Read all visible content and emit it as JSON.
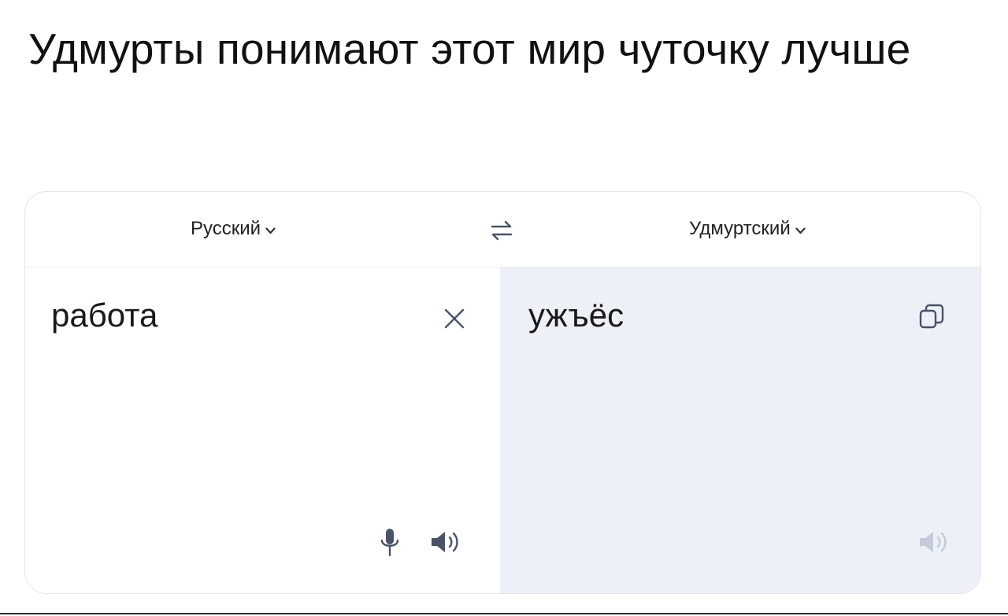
{
  "post": {
    "caption": "Удмурты понимают этот мир чуточку лучше"
  },
  "translator": {
    "source_language": "Русский",
    "target_language": "Удмуртский",
    "source_text": "работа",
    "translated_text": "ужъёс"
  },
  "icons": {
    "source_chevron": "chevron-down-icon",
    "target_chevron": "chevron-down-icon",
    "swap": "swap-arrows-icon",
    "clear": "close-icon",
    "copy": "copy-icon",
    "microphone": "microphone-icon",
    "source_speaker": "speaker-icon",
    "target_speaker": "speaker-icon"
  },
  "colors": {
    "card_border": "#e3e5ea",
    "target_pane_background": "#eef0f7",
    "icon_active": "#4a5268",
    "icon_muted": "#c5cad8"
  }
}
